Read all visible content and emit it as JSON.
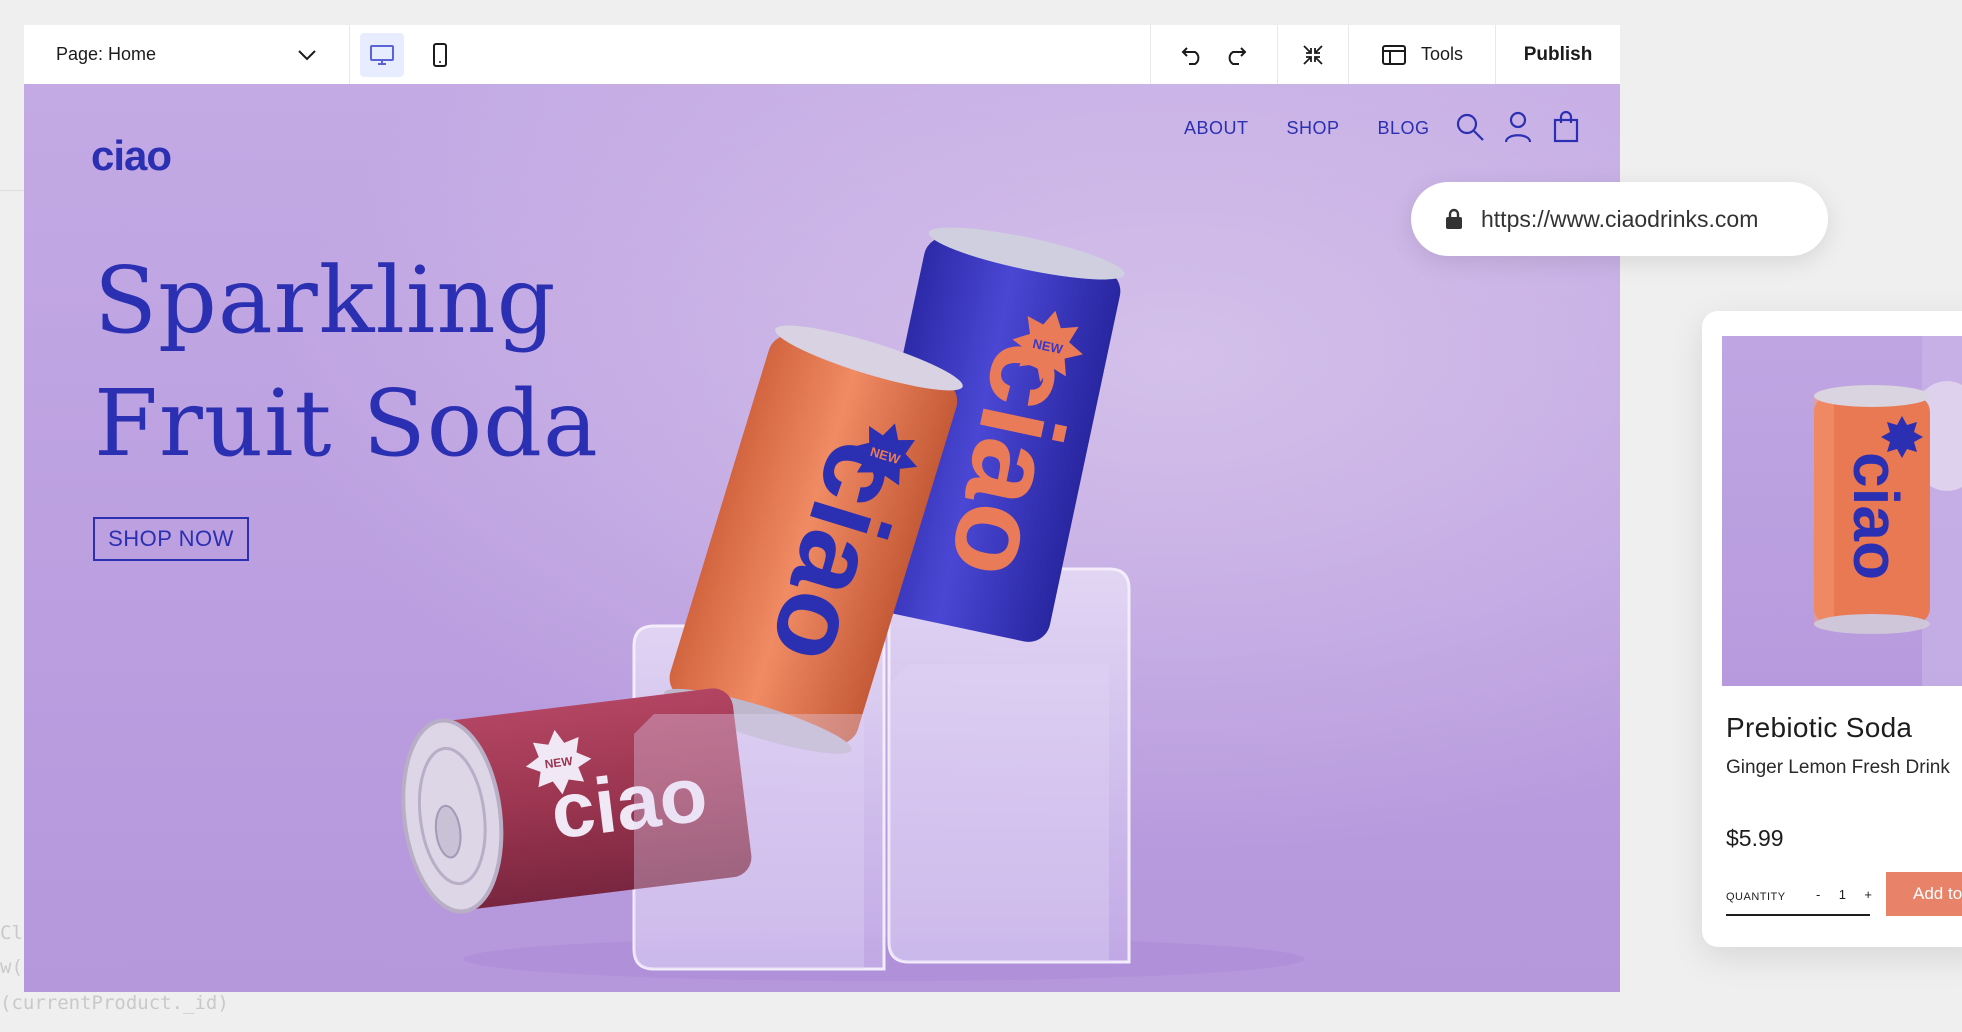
{
  "editor": {
    "page_select": "Page: Home",
    "tools_label": "Tools",
    "publish_label": "Publish",
    "code_lines": [
      "Clic",
      "w('",
      "(currentProduct._id)"
    ]
  },
  "site": {
    "logo": "ciao",
    "nav": [
      "ABOUT",
      "SHOP",
      "BLOG"
    ],
    "hero_line1": "Sparkling",
    "hero_line2": "Fruit Soda",
    "cta": "SHOP NOW",
    "can_brand": "ciao",
    "can_badge": "NEW"
  },
  "url_bar": {
    "url": "https://www.ciaodrinks.com"
  },
  "product": {
    "name": "Prebiotic Soda",
    "subtitle": "Ginger Lemon Fresh Drink",
    "price": "$5.99",
    "quantity_label": "QUANTITY",
    "quantity": "1",
    "minus": "-",
    "plus": "+",
    "add_label": "Add to Cart"
  },
  "colors": {
    "brand_blue": "#2b2fb2",
    "canvas_lilac": "#c3aae4",
    "can_orange": "#ea7b58",
    "can_blue": "#3d39c4",
    "can_red": "#9b3550",
    "add_button": "#e8836a"
  }
}
